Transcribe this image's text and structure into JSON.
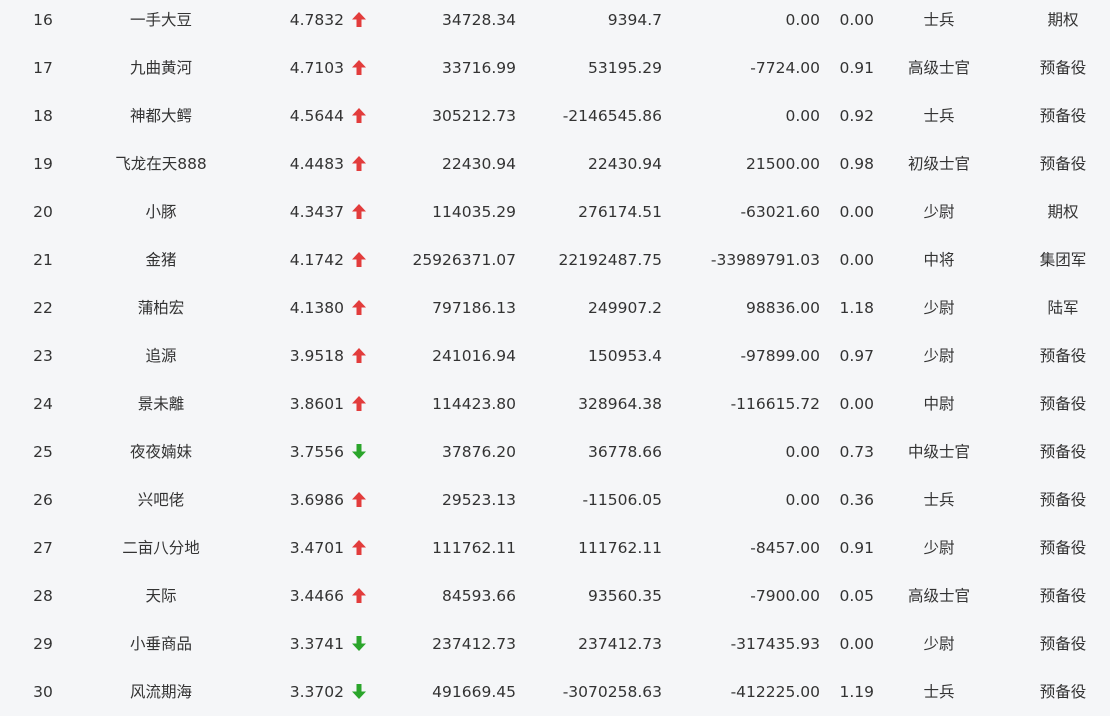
{
  "colors": {
    "up": "#e23c3c",
    "down": "#2ba52b",
    "text": "#333333",
    "background": "#f5f6f8"
  },
  "rows": [
    {
      "rank": "16",
      "name": "一手大豆",
      "score": "4.7832",
      "trend": "up",
      "v1": "34728.34",
      "v2": "9394.7",
      "v3": "0.00",
      "ratio": "0.00",
      "title": "士兵",
      "type": "期权"
    },
    {
      "rank": "17",
      "name": "九曲黄河",
      "score": "4.7103",
      "trend": "up",
      "v1": "33716.99",
      "v2": "53195.29",
      "v3": "-7724.00",
      "ratio": "0.91",
      "title": "高级士官",
      "type": "预备役"
    },
    {
      "rank": "18",
      "name": "神都大鳄",
      "score": "4.5644",
      "trend": "up",
      "v1": "305212.73",
      "v2": "-2146545.86",
      "v3": "0.00",
      "ratio": "0.92",
      "title": "士兵",
      "type": "预备役"
    },
    {
      "rank": "19",
      "name": "飞龙在天888",
      "score": "4.4483",
      "trend": "up",
      "v1": "22430.94",
      "v2": "22430.94",
      "v3": "21500.00",
      "ratio": "0.98",
      "title": "初级士官",
      "type": "预备役"
    },
    {
      "rank": "20",
      "name": "小豚",
      "score": "4.3437",
      "trend": "up",
      "v1": "114035.29",
      "v2": "276174.51",
      "v3": "-63021.60",
      "ratio": "0.00",
      "title": "少尉",
      "type": "期权"
    },
    {
      "rank": "21",
      "name": "金猪",
      "score": "4.1742",
      "trend": "up",
      "v1": "25926371.07",
      "v2": "22192487.75",
      "v3": "-33989791.03",
      "ratio": "0.00",
      "title": "中将",
      "type": "集团军"
    },
    {
      "rank": "22",
      "name": "蒲柏宏",
      "score": "4.1380",
      "trend": "up",
      "v1": "797186.13",
      "v2": "249907.2",
      "v3": "98836.00",
      "ratio": "1.18",
      "title": "少尉",
      "type": "陆军"
    },
    {
      "rank": "23",
      "name": "追源",
      "score": "3.9518",
      "trend": "up",
      "v1": "241016.94",
      "v2": "150953.4",
      "v3": "-97899.00",
      "ratio": "0.97",
      "title": "少尉",
      "type": "预备役"
    },
    {
      "rank": "24",
      "name": "景未離",
      "score": "3.8601",
      "trend": "up",
      "v1": "114423.80",
      "v2": "328964.38",
      "v3": "-116615.72",
      "ratio": "0.00",
      "title": "中尉",
      "type": "预备役"
    },
    {
      "rank": "25",
      "name": "夜夜婻妹",
      "score": "3.7556",
      "trend": "down",
      "v1": "37876.20",
      "v2": "36778.66",
      "v3": "0.00",
      "ratio": "0.73",
      "title": "中级士官",
      "type": "预备役"
    },
    {
      "rank": "26",
      "name": "兴吧佬",
      "score": "3.6986",
      "trend": "up",
      "v1": "29523.13",
      "v2": "-11506.05",
      "v3": "0.00",
      "ratio": "0.36",
      "title": "士兵",
      "type": "预备役"
    },
    {
      "rank": "27",
      "name": "二亩八分地",
      "score": "3.4701",
      "trend": "up",
      "v1": "111762.11",
      "v2": "111762.11",
      "v3": "-8457.00",
      "ratio": "0.91",
      "title": "少尉",
      "type": "预备役"
    },
    {
      "rank": "28",
      "name": "天际",
      "score": "3.4466",
      "trend": "up",
      "v1": "84593.66",
      "v2": "93560.35",
      "v3": "-7900.00",
      "ratio": "0.05",
      "title": "高级士官",
      "type": "预备役"
    },
    {
      "rank": "29",
      "name": "小垂商品",
      "score": "3.3741",
      "trend": "down",
      "v1": "237412.73",
      "v2": "237412.73",
      "v3": "-317435.93",
      "ratio": "0.00",
      "title": "少尉",
      "type": "预备役"
    },
    {
      "rank": "30",
      "name": "风流期海",
      "score": "3.3702",
      "trend": "down",
      "v1": "491669.45",
      "v2": "-3070258.63",
      "v3": "-412225.00",
      "ratio": "1.19",
      "title": "士兵",
      "type": "预备役"
    }
  ]
}
